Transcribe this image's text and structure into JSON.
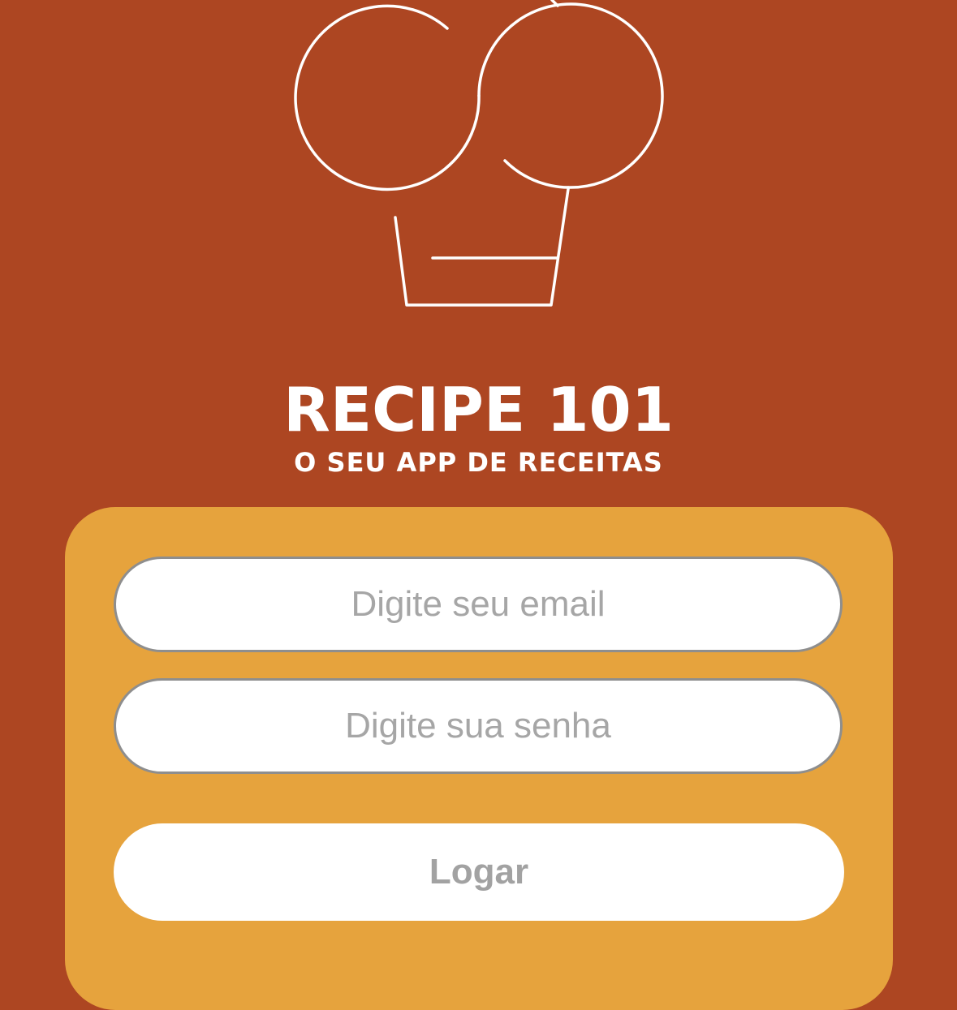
{
  "app": {
    "title": "RECIPE 101",
    "subtitle": "O SEU APP DE RECEITAS"
  },
  "logo": {
    "icon": "chef-hat-icon"
  },
  "login": {
    "email_placeholder": "Digite seu email",
    "email_value": "",
    "password_placeholder": "Digite sua senha",
    "password_value": "",
    "button_label": "Logar"
  },
  "colors": {
    "background": "#AD4622",
    "card": "#E6A33D",
    "field": "#FFFFFF",
    "placeholder_text": "#A6A6A6",
    "button_text": "#A2A2A2",
    "logo_stroke": "#FFFFFF"
  }
}
